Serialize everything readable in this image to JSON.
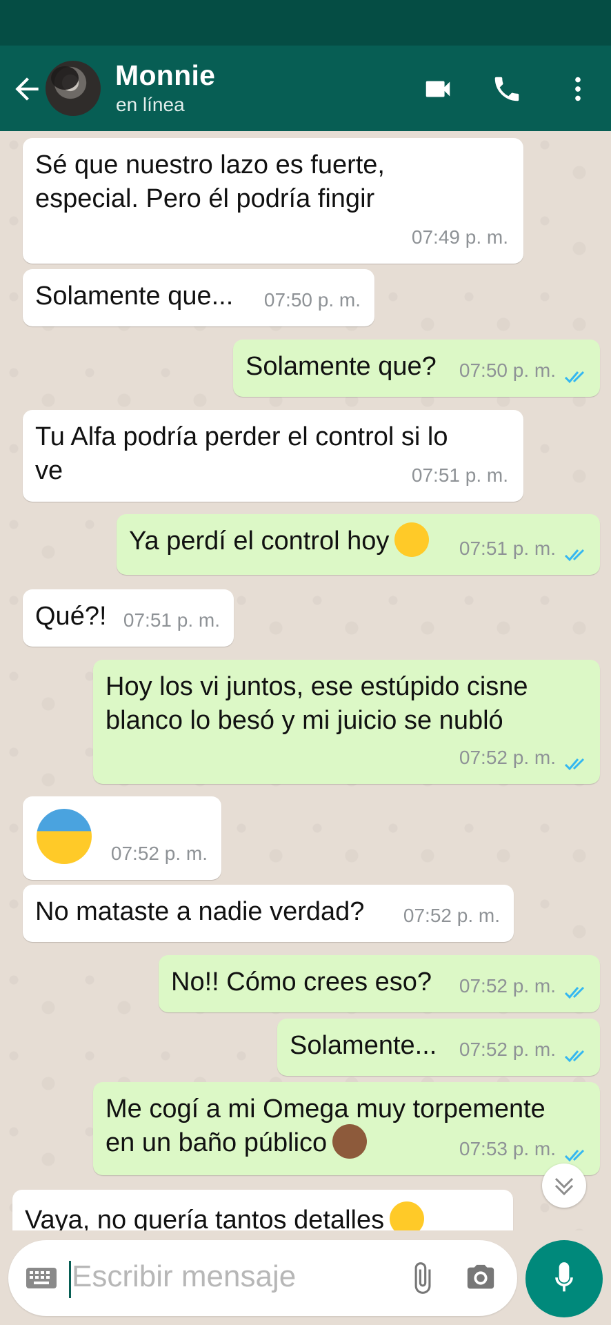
{
  "header": {
    "contact_name": "Monnie",
    "contact_status": "en línea",
    "icons": [
      "back-arrow-icon",
      "video-call-icon",
      "phone-icon",
      "more-vert-icon"
    ]
  },
  "colors": {
    "header": "#075e54",
    "statusbar": "#054d44",
    "outgoing_bubble": "#dcf8c6",
    "incoming_bubble": "#ffffff",
    "chat_background": "#e6ddd4",
    "read_ticks": "#34b7f1",
    "mic_button": "#00897b"
  },
  "messages": [
    {
      "direction": "in",
      "line1": "Sé que nuestro lazo es fuerte,",
      "line2": "especial. Pero él podría fingir",
      "time": "07:49 p. m."
    },
    {
      "direction": "in",
      "text": "Solamente que...",
      "time": "07:50 p. m."
    },
    {
      "direction": "out",
      "text": "Solamente que?",
      "time": "07:50 p. m.",
      "status": "read"
    },
    {
      "direction": "in",
      "line1": "Tu Alfa podría perder el control si lo",
      "line2": "ve",
      "time": "07:51 p. m."
    },
    {
      "direction": "out",
      "text": "Ya perdí el control hoy",
      "emoji": "confounded-face",
      "time": "07:51 p. m.",
      "status": "read"
    },
    {
      "direction": "in",
      "text": "Qué?!",
      "time": "07:51 p. m."
    },
    {
      "direction": "out",
      "line1": "Hoy los vi juntos, ese estúpido cisne",
      "line2": "blanco lo besó y mi juicio se nubló",
      "time": "07:52 p. m.",
      "status": "read"
    },
    {
      "direction": "in",
      "emoji": "fearful-face",
      "time": "07:52 p. m."
    },
    {
      "direction": "in",
      "text": "No mataste a nadie verdad?",
      "time": "07:52 p. m."
    },
    {
      "direction": "out",
      "text": "No!! Cómo crees eso?",
      "time": "07:52 p. m.",
      "status": "read"
    },
    {
      "direction": "out",
      "text": "Solamente...",
      "time": "07:52 p. m.",
      "status": "read"
    },
    {
      "direction": "out",
      "line1": "Me cogí a mi Omega muy torpemente",
      "line2": "en un baño público",
      "emoji": "see-no-evil-monkey",
      "time": "07:53 p. m.",
      "status": "read"
    },
    {
      "direction": "in",
      "text": "Vaya, no quería tantos detalles",
      "emoji": "expressionless-face"
    }
  ],
  "composer": {
    "placeholder": "Escribir mensaje",
    "icons": [
      "keyboard-icon",
      "attach-icon",
      "camera-icon",
      "mic-icon",
      "scroll-down-icon"
    ]
  }
}
